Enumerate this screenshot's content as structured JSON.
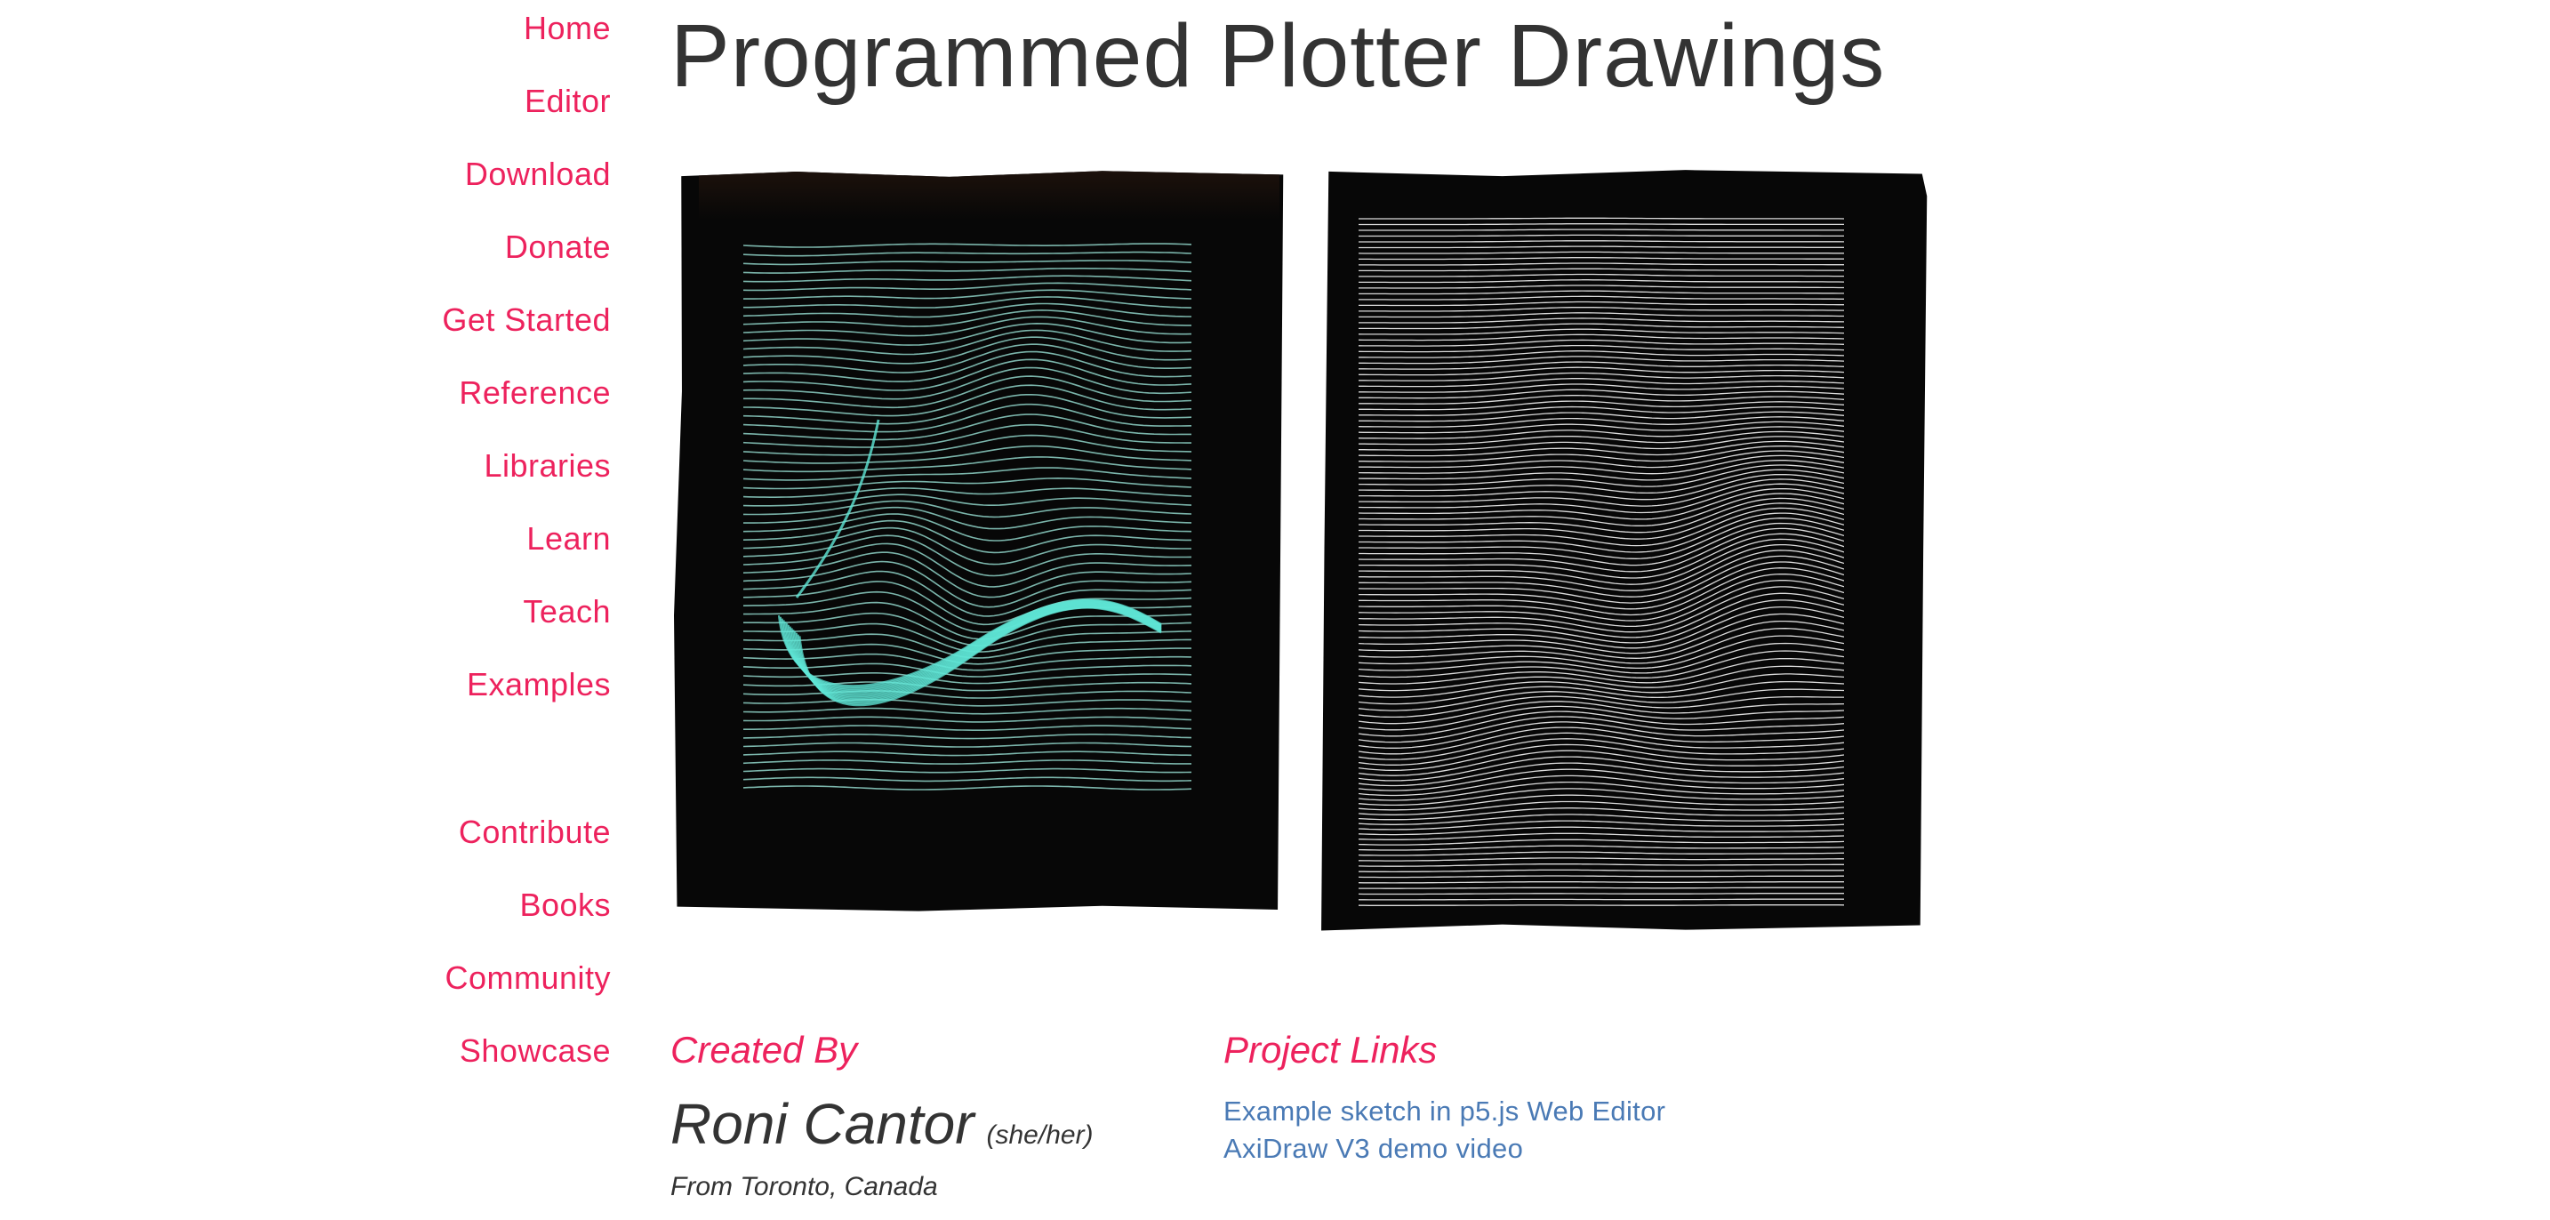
{
  "sidebar": {
    "items": [
      {
        "label": "Home"
      },
      {
        "label": "Editor"
      },
      {
        "label": "Download"
      },
      {
        "label": "Donate"
      },
      {
        "label": "Get Started"
      },
      {
        "label": "Reference"
      },
      {
        "label": "Libraries"
      },
      {
        "label": "Learn"
      },
      {
        "label": "Teach"
      },
      {
        "label": "Examples"
      },
      {
        "label": "Contribute"
      },
      {
        "label": "Books"
      },
      {
        "label": "Community"
      },
      {
        "label": "Showcase"
      }
    ]
  },
  "page": {
    "title": "Programmed Plotter Drawings"
  },
  "artwork": {
    "left_line_color": "#8fd3c8",
    "left_highlight_color": "#5fe6d6",
    "right_line_color": "#f2f2f2",
    "background_color": "#070707"
  },
  "created_by": {
    "heading": "Created By",
    "name": "Roni Cantor",
    "pronouns": "(she/her)",
    "location": "From Toronto, Canada"
  },
  "project_links": {
    "heading": "Project Links",
    "links": [
      {
        "label": "Example sketch in p5.js Web Editor"
      },
      {
        "label": "AxiDraw V3 demo video"
      }
    ]
  },
  "colors": {
    "accent": "#ED225D",
    "link": "#4A7AB5",
    "text": "#333333"
  }
}
